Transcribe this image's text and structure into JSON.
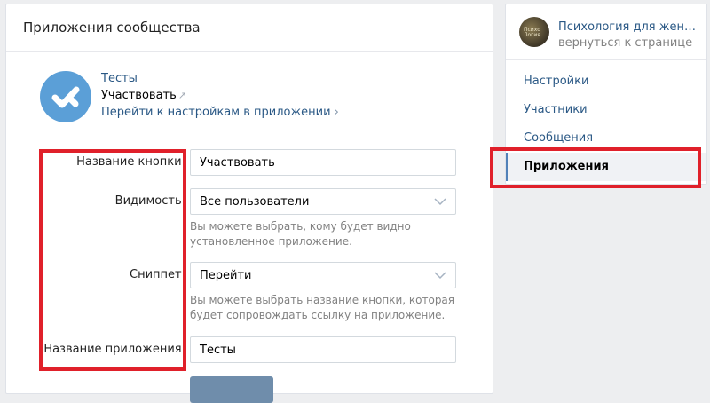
{
  "header": {
    "title": "Приложения сообщества"
  },
  "app": {
    "title": "Тесты",
    "action_label": "Участвовать",
    "settings_link": "Перейти к настройкам в приложении",
    "icon": "checkmark-icon",
    "icon_color": "#5b9fd7"
  },
  "form": {
    "button_name": {
      "label": "Название кнопки:",
      "value": "Участвовать"
    },
    "visibility": {
      "label": "Видимость:",
      "value": "Все пользователи",
      "hint": "Вы можете выбрать, кому будет видно установленное приложение."
    },
    "snippet": {
      "label": "Сниппет:",
      "value": "Перейти",
      "hint": "Вы можете выбрать название кнопки, которая будет сопровождать ссылку на приложение."
    },
    "app_name": {
      "label": "Название приложения:",
      "value": "Тесты"
    }
  },
  "sidebar": {
    "group_name": "Психология для женщин",
    "back_link": "вернуться к странице",
    "avatar_text": "Психо Логия",
    "items": [
      {
        "label": "Настройки",
        "active": false
      },
      {
        "label": "Участники",
        "active": false
      },
      {
        "label": "Сообщения",
        "active": false
      },
      {
        "label": "Приложения",
        "active": true
      }
    ]
  },
  "colors": {
    "link": "#2a5885",
    "highlight": "#e0202a",
    "button": "#6f8dab",
    "active_marker": "#5181b8"
  }
}
